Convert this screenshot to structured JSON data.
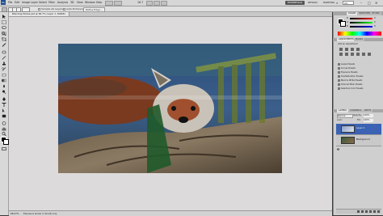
{
  "app": {
    "logo": "Ps"
  },
  "menu": [
    "File",
    "Edit",
    "Image",
    "Layer",
    "Select",
    "Filter",
    "Analysis",
    "3D",
    "View",
    "Window",
    "Help"
  ],
  "zoom_display": "16.7",
  "workspaces": [
    "ESSENTIALS",
    "DESIGN",
    "PAINTING"
  ],
  "workspace_active": "ESSENTIALS",
  "cs_live": "CS Live",
  "options_bar": {
    "sample_all_layers": "Sample All Layers",
    "auto_enhance": "Auto-Enhance",
    "refine_edge": "Refine Edge..."
  },
  "document": {
    "tab_title": "Blending Modes.psd @ 66.7% (Layer 1, RGB/8)",
    "zoom_status": "66.67%",
    "doc_status": "Exposure works in 32-bit only"
  },
  "panels": {
    "color_tabs": [
      "COLOR",
      "SWATCHES",
      "STYLES"
    ],
    "color_sliders": [
      {
        "channel": "R",
        "value": "0"
      },
      {
        "channel": "G",
        "value": "0"
      },
      {
        "channel": "B",
        "value": "0"
      }
    ],
    "adjustments_tabs": [
      "ADJUSTMENTS",
      "MASKS"
    ],
    "adjustments_header": "Add an adjustment",
    "adjustments_presets": [
      "Levels Presets",
      "Curves Presets",
      "Exposure Presets",
      "Hue/Saturation Presets",
      "Black & White Presets",
      "Channel Mixer Presets",
      "Selective Color Presets"
    ],
    "layers_tabs": [
      "LAYERS",
      "CHANNELS",
      "PATHS"
    ],
    "blend_mode": "Normal",
    "opacity_label": "Opacity:",
    "opacity_value": "100%",
    "fill_label": "Fill:",
    "fill_value": "100%",
    "lock_label": "Lock:",
    "layers": [
      {
        "name": "Layer 1",
        "selected": true
      },
      {
        "name": "Background",
        "selected": false
      }
    ]
  },
  "colors": {
    "workspace_active_bg": "#555555",
    "layer_selected": "#3b62b3",
    "canvas_bg": "#dcdada"
  }
}
